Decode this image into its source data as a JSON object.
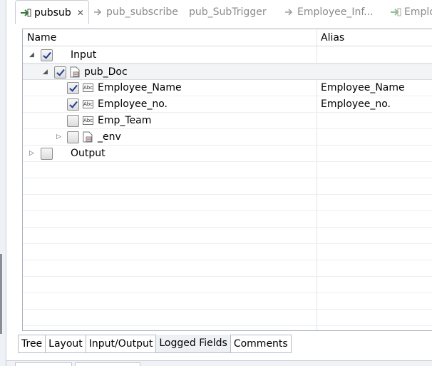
{
  "editor_tabs": [
    {
      "label": "pubsub",
      "active": true
    },
    {
      "label": "pub_subscribe"
    },
    {
      "label": "pub_SubTrigger"
    },
    {
      "label": "Employee_Inf..."
    },
    {
      "label": "Emplo"
    }
  ],
  "table": {
    "headers": [
      "Name",
      "Alias"
    ],
    "rows": [
      {
        "label": "Input",
        "checked": true,
        "alias": ""
      },
      {
        "label": "pub_Doc",
        "checked": true,
        "alias": ""
      },
      {
        "label": "Employee_Name",
        "checked": true,
        "alias": "Employee_Name"
      },
      {
        "label": "Employee_no.",
        "checked": true,
        "alias": "Employee_no."
      },
      {
        "label": "Emp_Team",
        "checked": false,
        "alias": ""
      },
      {
        "label": "_env",
        "checked": false,
        "alias": ""
      },
      {
        "label": "Output",
        "checked": false,
        "alias": ""
      }
    ],
    "field_icon_text": "Abc"
  },
  "bottom_tabs": [
    "Tree",
    "Layout",
    "Input/Output",
    "Logged Fields",
    "Comments"
  ],
  "colors": {
    "checkmark": "#1d3f8f",
    "border": "#a9b0b9"
  }
}
